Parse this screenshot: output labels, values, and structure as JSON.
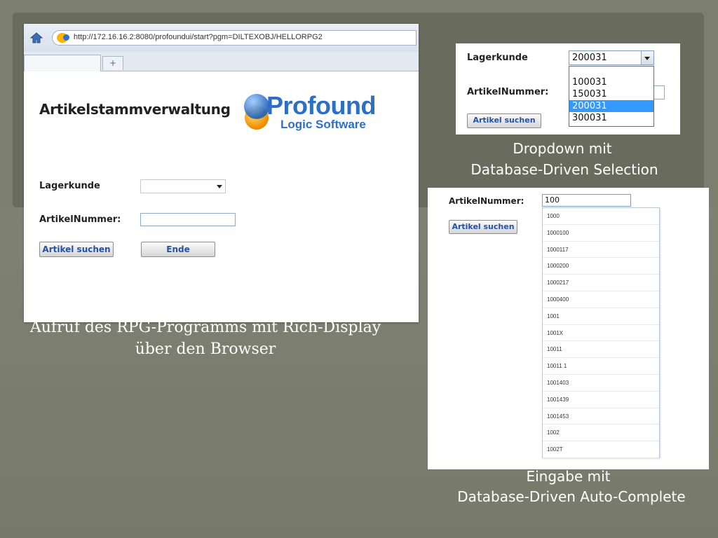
{
  "browser": {
    "url": "http://172.16.16.2:8080/profoundui/start?pgm=DILTEXOBJ/HELLORPG2",
    "new_tab_symbol": "+",
    "page_title": "Artikelstammverwaltung",
    "logo": {
      "word": "Profound",
      "sub": "Logic Software",
      "icon": "profound-logo-icon"
    },
    "labels": {
      "lagerkunde": "Lagerkunde",
      "artikelnummer": "ArtikelNummer:"
    },
    "buttons": {
      "search": "Artikel suchen",
      "end": "Ende"
    },
    "icons": {
      "home": "home-icon",
      "site": "site-favicon"
    }
  },
  "captions": {
    "browser": [
      "Aufruf des RPG-Programms mit Rich-Display",
      "über den Browser"
    ],
    "dropdown": [
      "Dropdown mit",
      "Database-Driven Selection"
    ],
    "autocomplete": [
      "Eingabe mit",
      "Database-Driven Auto-Complete"
    ]
  },
  "dropdown_panel": {
    "label_lagerkunde": "Lagerkunde",
    "label_artikelnummer": "ArtikelNummer:",
    "selected_value": "200031",
    "options": [
      "100031",
      "150031",
      "200031",
      "300031"
    ],
    "highlighted_option": "200031",
    "button": "Artikel suchen"
  },
  "autocomplete_panel": {
    "label": "ArtikelNummer:",
    "input_value": "100",
    "button": "Artikel suchen",
    "suggestions": [
      "1000",
      "1000100",
      "1000117",
      "1000200",
      "1000217",
      "1000400",
      "1001",
      "1001X",
      "10011",
      "10011 1",
      "1001403",
      "1001439",
      "1001453",
      "1002",
      "1002T"
    ]
  },
  "colors": {
    "background": "#7c7e70",
    "frame": "#696b5c",
    "link_button_text": "#2451a6",
    "highlight": "#3399ff",
    "logo_blue": "#2e6fc6"
  }
}
